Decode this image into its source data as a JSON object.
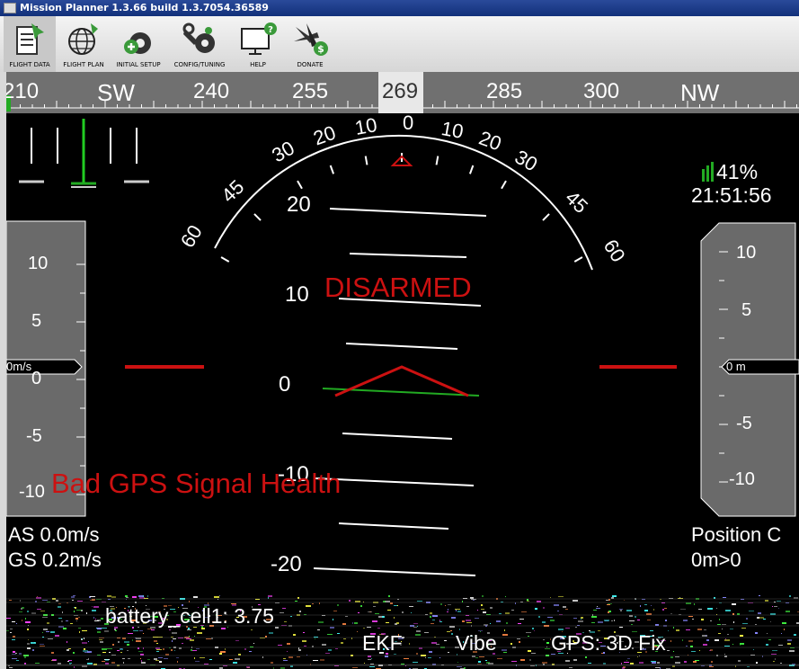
{
  "window": {
    "title": "Mission Planner 1.3.66 build 1.3.7054.36589"
  },
  "toolbar": {
    "items": [
      {
        "label": "FLIGHT DATA",
        "icon": "flight-data-icon",
        "active": true
      },
      {
        "label": "FLIGHT PLAN",
        "icon": "flight-plan-icon",
        "active": false
      },
      {
        "label": "INITIAL SETUP",
        "icon": "initial-setup-icon",
        "active": false
      },
      {
        "label": "CONFIG/TUNING",
        "icon": "config-tuning-icon",
        "active": false
      },
      {
        "label": "HELP",
        "icon": "help-icon",
        "active": false
      },
      {
        "label": "DONATE",
        "icon": "donate-icon",
        "active": false
      }
    ]
  },
  "heading": {
    "current": "269",
    "labels": [
      "210",
      "SW",
      "240",
      "255",
      "285",
      "300",
      "NW"
    ]
  },
  "roll_scale": [
    "60",
    "45",
    "30",
    "20",
    "10",
    "0",
    "10",
    "20",
    "30",
    "45",
    "60"
  ],
  "pitch_scale": [
    "20",
    "10",
    "0",
    "-10",
    "-20"
  ],
  "status": {
    "armed": "DISARMED",
    "warning": "Bad GPS Signal Health"
  },
  "battery_signal": {
    "percent": "41%",
    "time": "21:51:56"
  },
  "speed_tape": {
    "ticks": [
      "10",
      "5",
      "0",
      "-5",
      "-10"
    ],
    "value": "0m/s"
  },
  "alt_tape": {
    "ticks": [
      "10",
      "5",
      "0",
      "-5",
      "-10"
    ],
    "value": "0 m"
  },
  "speeds": {
    "as": "AS 0.0m/s",
    "gs": "GS 0.2m/s"
  },
  "position": {
    "label": "Position C",
    "value": "0m>0"
  },
  "messages": {
    "battery": "battery_cell1: 3.75"
  },
  "indicators": {
    "ekf": "EKF",
    "vibe": "Vibe",
    "gps": "GPS: 3D Fix"
  },
  "colors": {
    "warning": "#cc1111",
    "horizon": "#22aa22",
    "accent_green": "#22aa22",
    "white": "#ffffff"
  }
}
